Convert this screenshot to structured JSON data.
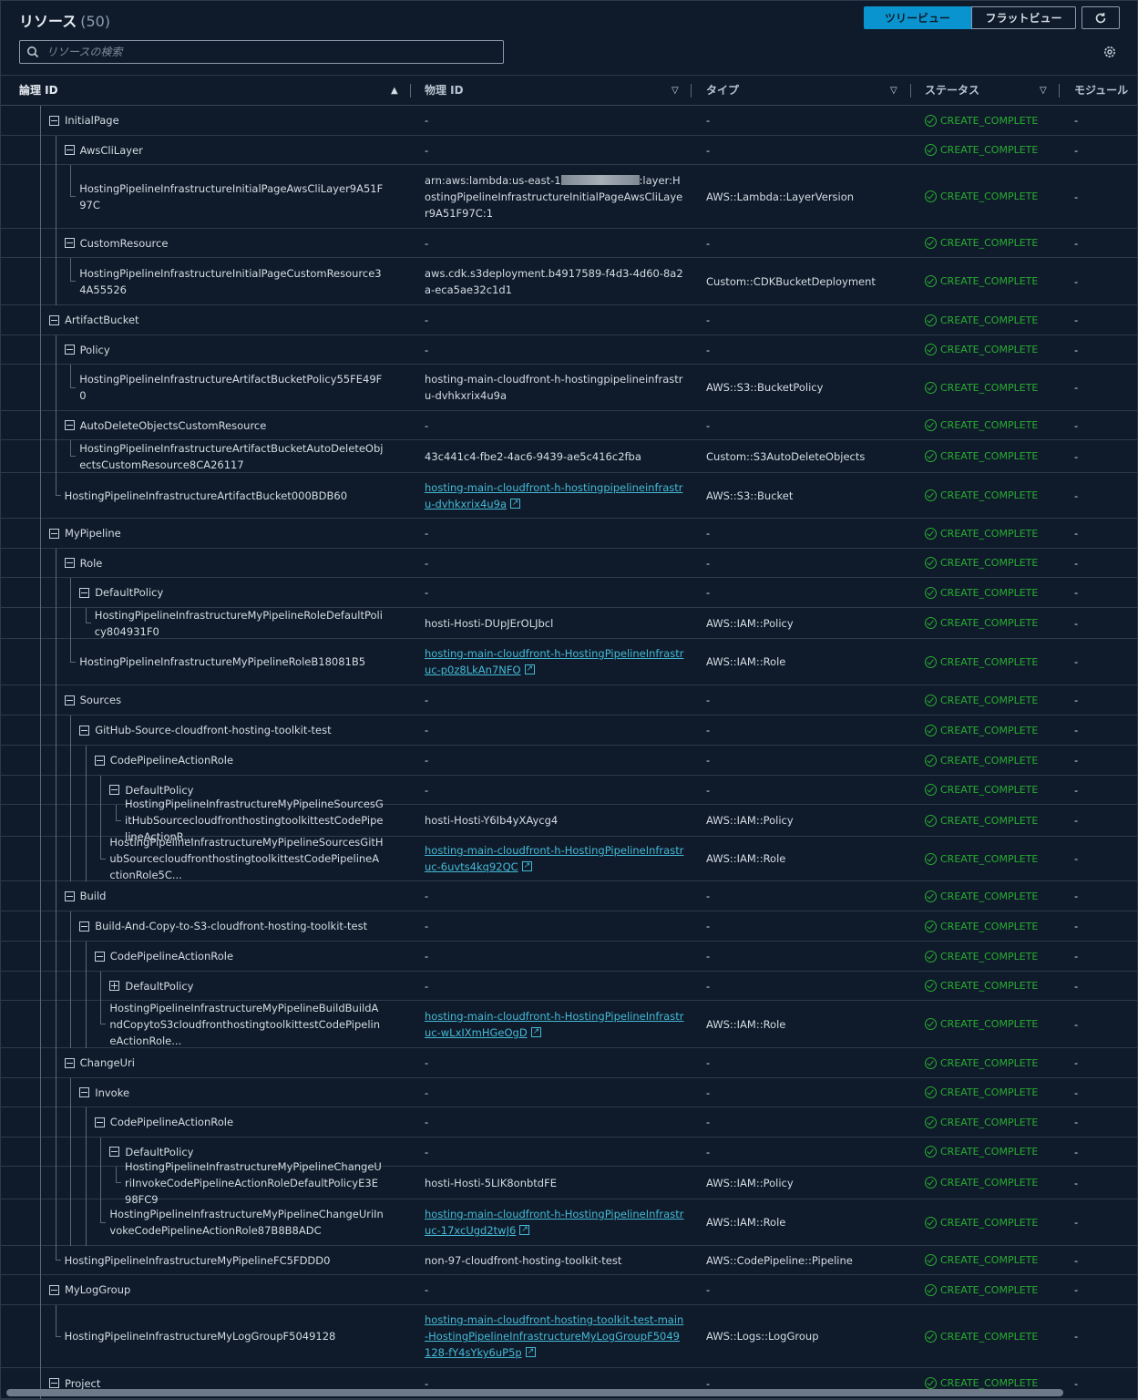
{
  "header": {
    "title": "リソース",
    "count": "(50)"
  },
  "view_toggle": {
    "tree_label": "ツリービュー",
    "flat_label": "フラットビュー"
  },
  "search": {
    "placeholder": "リソースの検索"
  },
  "columns": {
    "logical_id": "論理 ID",
    "physical_id": "物理 ID",
    "type": "タイプ",
    "status": "ステータス",
    "module": "モジュール"
  },
  "icons": {
    "search": "search-icon",
    "refresh": "refresh-icon",
    "settings": "gear-icon",
    "sort_asc": "sort-ascending-icon",
    "sort_filter": "sort-descending-outline-icon",
    "collapse": "collapse-box-icon",
    "expand": "expand-box-icon",
    "external": "external-link-icon",
    "status": "check-circle-icon"
  },
  "colors": {
    "accent": "#0a94cf",
    "status_ok": "#29ad32",
    "link": "#44b9d6",
    "background": "#0f1b2a"
  },
  "rows": [
    {
      "logical": "InitialPage",
      "toggle": "minus",
      "depth": 0,
      "physical": "-",
      "type": "-",
      "status": "CREATE_COMPLETE",
      "module": "-",
      "h": 33
    },
    {
      "logical": "AwsCliLayer",
      "toggle": "minus",
      "depth": 1,
      "physical": "-",
      "type": "-",
      "status": "CREATE_COMPLETE",
      "module": "-",
      "h": 32
    },
    {
      "logical": "HostingPipelineInfrastructureInitialPageAwsCliLayer9A51F97C",
      "toggle": "",
      "depth": 2,
      "physical_pre": "arn:aws:lambda:us-east-1",
      "redacted": true,
      "physical": ":layer:HostingPipelineInfrastructureInitialPageAwsCliLayer9A51F97C:1",
      "type": "AWS::Lambda::LayerVersion",
      "status": "CREATE_COMPLETE",
      "module": "-",
      "h": 70
    },
    {
      "logical": "CustomResource",
      "toggle": "minus",
      "depth": 1,
      "physical": "-",
      "type": "-",
      "status": "CREATE_COMPLETE",
      "module": "-",
      "h": 32
    },
    {
      "logical": "HostingPipelineInfrastructureInitialPageCustomResource34A55526",
      "toggle": "",
      "depth": 2,
      "physical": "aws.cdk.s3deployment.b4917589-f4d3-4d60-8a2a-eca5ae32c1d1",
      "type": "Custom::CDKBucketDeployment",
      "status": "CREATE_COMPLETE",
      "module": "-",
      "h": 52
    },
    {
      "logical": "ArtifactBucket",
      "toggle": "minus",
      "depth": 0,
      "physical": "-",
      "type": "-",
      "status": "CREATE_COMPLETE",
      "module": "-",
      "h": 33
    },
    {
      "logical": "Policy",
      "toggle": "minus",
      "depth": 1,
      "physical": "-",
      "type": "-",
      "status": "CREATE_COMPLETE",
      "module": "-",
      "h": 32
    },
    {
      "logical": "HostingPipelineInfrastructureArtifactBucketPolicy55FE49F0",
      "toggle": "",
      "depth": 2,
      "physical": "hosting-main-cloudfront-h-hostingpipelineinfrastru-dvhkxrix4u9a",
      "type": "AWS::S3::BucketPolicy",
      "status": "CREATE_COMPLETE",
      "module": "-",
      "h": 51
    },
    {
      "logical": "AutoDeleteObjectsCustomResource",
      "toggle": "minus",
      "depth": 1,
      "physical": "-",
      "type": "-",
      "status": "CREATE_COMPLETE",
      "module": "-",
      "h": 32
    },
    {
      "logical": "HostingPipelineInfrastructureArtifactBucketAutoDeleteObjectsCustomResource8CA26117",
      "toggle": "",
      "depth": 2,
      "physical": "43c441c4-fbe2-4ac6-9439-ae5c416c2fba",
      "type": "Custom::S3AutoDeleteObjects",
      "status": "CREATE_COMPLETE",
      "module": "-",
      "h": 36
    },
    {
      "logical": "HostingPipelineInfrastructureArtifactBucket000BDB60",
      "toggle": "",
      "depth": 1,
      "physical": "hosting-main-cloudfront-h-hostingpipelineinfrastru-dvhkxrix4u9a",
      "link": true,
      "type": "AWS::S3::Bucket",
      "status": "CREATE_COMPLETE",
      "module": "-",
      "h": 50
    },
    {
      "logical": "MyPipeline",
      "toggle": "minus",
      "depth": 0,
      "physical": "-",
      "type": "-",
      "status": "CREATE_COMPLETE",
      "module": "-",
      "h": 33
    },
    {
      "logical": "Role",
      "toggle": "minus",
      "depth": 1,
      "physical": "-",
      "type": "-",
      "status": "CREATE_COMPLETE",
      "module": "-",
      "h": 32
    },
    {
      "logical": "DefaultPolicy",
      "toggle": "minus",
      "depth": 2,
      "physical": "-",
      "type": "-",
      "status": "CREATE_COMPLETE",
      "module": "-",
      "h": 33
    },
    {
      "logical": "HostingPipelineInfrastructureMyPipelineRoleDefaultPolicy804931F0",
      "toggle": "",
      "depth": 3,
      "physical": "hosti-Hosti-DUpJErOLJbcl",
      "type": "AWS::IAM::Policy",
      "status": "CREATE_COMPLETE",
      "module": "-",
      "h": 34
    },
    {
      "logical": "HostingPipelineInfrastructureMyPipelineRoleB18081B5",
      "toggle": "",
      "depth": 2,
      "physical": "hosting-main-cloudfront-h-HostingPipelineInfrastruc-p0z8LkAn7NFO",
      "link": true,
      "type": "AWS::IAM::Role",
      "status": "CREATE_COMPLETE",
      "module": "-",
      "h": 51
    },
    {
      "logical": "Sources",
      "toggle": "minus",
      "depth": 1,
      "physical": "-",
      "type": "-",
      "status": "CREATE_COMPLETE",
      "module": "-",
      "h": 33
    },
    {
      "logical": "GitHub-Source-cloudfront-hosting-toolkit-test",
      "toggle": "minus",
      "depth": 2,
      "physical": "-",
      "type": "-",
      "status": "CREATE_COMPLETE",
      "module": "-",
      "h": 33
    },
    {
      "logical": "CodePipelineActionRole",
      "toggle": "minus",
      "depth": 3,
      "physical": "-",
      "type": "-",
      "status": "CREATE_COMPLETE",
      "module": "-",
      "h": 33
    },
    {
      "logical": "DefaultPolicy",
      "toggle": "minus",
      "depth": 4,
      "physical": "-",
      "type": "-",
      "status": "CREATE_COMPLETE",
      "module": "-",
      "h": 32
    },
    {
      "logical": "HostingPipelineInfrastructureMyPipelineSourcesGitHubSourcecloudfronthostingtoolkittestCodePipelineActionR...",
      "toggle": "",
      "depth": 5,
      "physical": "hosti-Hosti-Y6Ib4yXAycg4",
      "type": "AWS::IAM::Policy",
      "status": "CREATE_COMPLETE",
      "module": "-",
      "h": 35
    },
    {
      "logical": "HostingPipelineInfrastructureMyPipelineSourcesGitHubSourcecloudfronthostingtoolkittestCodePipelineActionRole5C...",
      "toggle": "",
      "depth": 4,
      "physical": "hosting-main-cloudfront-h-HostingPipelineInfrastruc-6uvts4kq92QC",
      "link": true,
      "type": "AWS::IAM::Role",
      "status": "CREATE_COMPLETE",
      "module": "-",
      "h": 49
    },
    {
      "logical": "Build",
      "toggle": "minus",
      "depth": 1,
      "physical": "-",
      "type": "-",
      "status": "CREATE_COMPLETE",
      "module": "-",
      "h": 33
    },
    {
      "logical": "Build-And-Copy-to-S3-cloudfront-hosting-toolkit-test",
      "toggle": "minus",
      "depth": 2,
      "physical": "-",
      "type": "-",
      "status": "CREATE_COMPLETE",
      "module": "-",
      "h": 33
    },
    {
      "logical": "CodePipelineActionRole",
      "toggle": "minus",
      "depth": 3,
      "physical": "-",
      "type": "-",
      "status": "CREATE_COMPLETE",
      "module": "-",
      "h": 33
    },
    {
      "logical": "DefaultPolicy",
      "toggle": "plus",
      "depth": 4,
      "physical": "-",
      "type": "-",
      "status": "CREATE_COMPLETE",
      "module": "-",
      "h": 32
    },
    {
      "logical": "HostingPipelineInfrastructureMyPipelineBuildBuildAndCopytoS3cloudfronthostingtoolkittestCodePipelineActionRole...",
      "toggle": "",
      "depth": 4,
      "physical": "hosting-main-cloudfront-h-HostingPipelineInfrastruc-wLxIXmHGeOgD",
      "link": true,
      "type": "AWS::IAM::Role",
      "status": "CREATE_COMPLETE",
      "module": "-",
      "h": 52
    },
    {
      "logical": "ChangeUri",
      "toggle": "minus",
      "depth": 1,
      "physical": "-",
      "type": "-",
      "status": "CREATE_COMPLETE",
      "module": "-",
      "h": 33
    },
    {
      "logical": "Invoke",
      "toggle": "minus",
      "depth": 2,
      "physical": "-",
      "type": "-",
      "status": "CREATE_COMPLETE",
      "module": "-",
      "h": 32
    },
    {
      "logical": "CodePipelineActionRole",
      "toggle": "minus",
      "depth": 3,
      "physical": "-",
      "type": "-",
      "status": "CREATE_COMPLETE",
      "module": "-",
      "h": 33
    },
    {
      "logical": "DefaultPolicy",
      "toggle": "minus",
      "depth": 4,
      "physical": "-",
      "type": "-",
      "status": "CREATE_COMPLETE",
      "module": "-",
      "h": 32
    },
    {
      "logical": "HostingPipelineInfrastructureMyPipelineChangeUriInvokeCodePipelineActionRoleDefaultPolicyE3E98FC9",
      "toggle": "",
      "depth": 5,
      "physical": "hosti-Hosti-5LIK8onbtdFE",
      "type": "AWS::IAM::Policy",
      "status": "CREATE_COMPLETE",
      "module": "-",
      "h": 36
    },
    {
      "logical": "HostingPipelineInfrastructureMyPipelineChangeUriInvokeCodePipelineActionRole87B8B8ADC",
      "toggle": "",
      "depth": 4,
      "physical": "hosting-main-cloudfront-h-HostingPipelineInfrastruc-17xcUgd2twJ6",
      "link": true,
      "type": "AWS::IAM::Role",
      "status": "CREATE_COMPLETE",
      "module": "-",
      "h": 51
    },
    {
      "logical": "HostingPipelineInfrastructureMyPipelineFC5FDDD0",
      "toggle": "",
      "depth": 1,
      "physical": "non-97-cloudfront-hosting-toolkit-test",
      "type": "AWS::CodePipeline::Pipeline",
      "status": "CREATE_COMPLETE",
      "module": "-",
      "h": 32
    },
    {
      "logical": "MyLogGroup",
      "toggle": "minus",
      "depth": 0,
      "physical": "-",
      "type": "-",
      "status": "CREATE_COMPLETE",
      "module": "-",
      "h": 33
    },
    {
      "logical": "HostingPipelineInfrastructureMyLogGroupF5049128",
      "toggle": "",
      "depth": 1,
      "physical": "hosting-main-cloudfront-hosting-toolkit-test-main-HostingPipelineInfrastructureMyLogGroupF5049128-fY4sYky6uP5p",
      "link": true,
      "type": "AWS::Logs::LogGroup",
      "status": "CREATE_COMPLETE",
      "module": "-",
      "h": 69
    },
    {
      "logical": "Project",
      "toggle": "minus",
      "depth": 0,
      "physical": "-",
      "type": "-",
      "status": "CREATE_COMPLETE",
      "module": "-",
      "h": 34
    }
  ]
}
